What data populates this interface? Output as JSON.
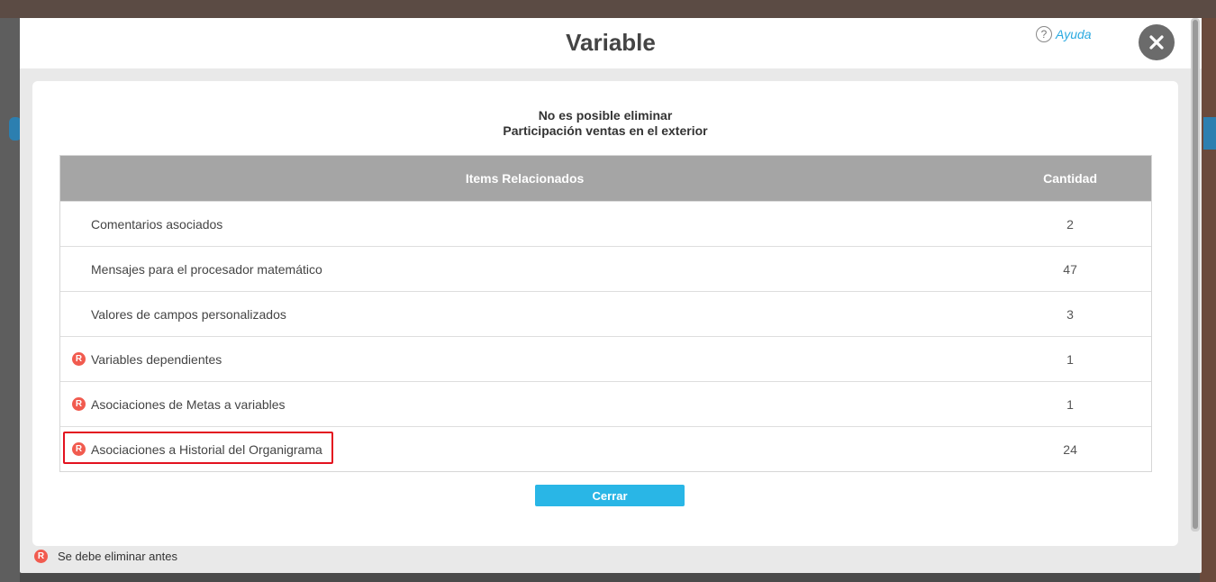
{
  "modal": {
    "title": "Variable",
    "help_label": "Ayuda",
    "help_icon_glyph": "?",
    "close_icon": "close-icon"
  },
  "message": {
    "line1": "No es posible eliminar",
    "line2": "Participación ventas en el exterior"
  },
  "table": {
    "headers": {
      "items": "Items Relacionados",
      "quantity": "Cantidad"
    },
    "rows": [
      {
        "label": "Comentarios asociados",
        "qty": "2",
        "required": false
      },
      {
        "label": "Mensajes para el procesador matemático",
        "qty": "47",
        "required": false
      },
      {
        "label": "Valores de campos personalizados",
        "qty": "3",
        "required": false
      },
      {
        "label": "Variables dependientes",
        "qty": "1",
        "required": true
      },
      {
        "label": "Asociaciones de Metas a variables",
        "qty": "1",
        "required": true
      },
      {
        "label": "Asociaciones a Historial del Organigrama",
        "qty": "24",
        "required": true,
        "highlighted": true
      }
    ]
  },
  "buttons": {
    "close_label": "Cerrar"
  },
  "legend": {
    "badge": "R",
    "text": "Se debe eliminar antes"
  },
  "colors": {
    "accent": "#29b6e6",
    "required_badge": "#f15b4f",
    "highlight": "#e3121f",
    "table_header": "#a5a5a5"
  }
}
